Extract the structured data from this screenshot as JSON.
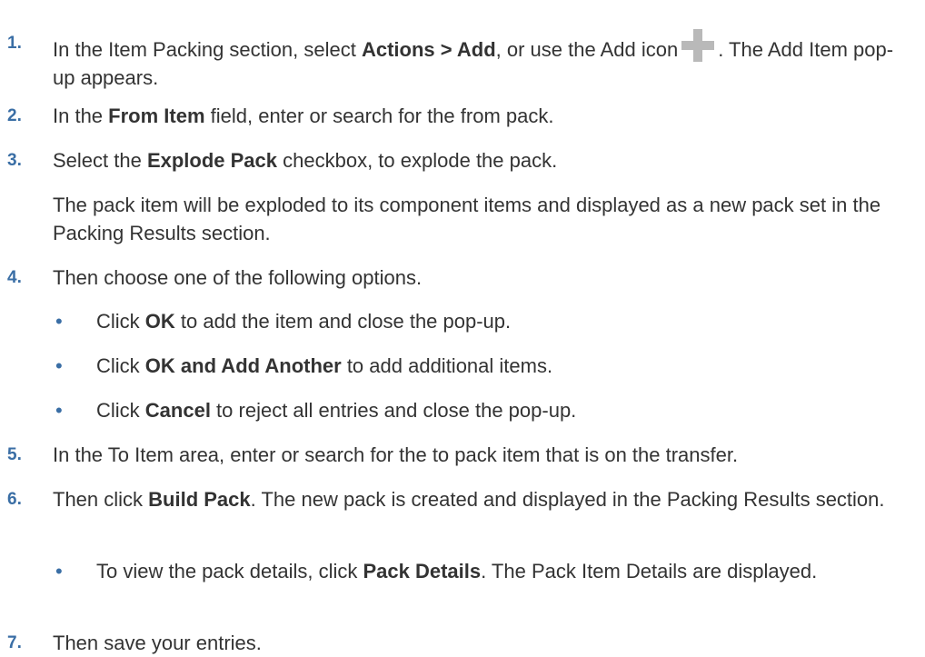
{
  "steps": [
    {
      "num": "1.",
      "a": "In the Item Packing section, select ",
      "b1": "Actions > Add",
      "c": ", or use the Add icon",
      "d": ". The Add Item pop-up appears.",
      "icon": "add-icon"
    },
    {
      "num": "2.",
      "a": "In the ",
      "b1": "From Item",
      "c": " field, enter or search for the from pack."
    },
    {
      "num": "3.",
      "a": "Select the ",
      "b1": "Explode Pack",
      "c": " checkbox, to explode the pack.",
      "para": "The pack item will be exploded to its component items and displayed as a new pack set in the Packing Results section."
    },
    {
      "num": "4.",
      "text": "Then choose one of the following options.",
      "bullets": [
        {
          "a": "Click ",
          "b1": "OK",
          "c": " to add the item and close the pop-up."
        },
        {
          "a": "Click ",
          "b1": "OK and Add Another",
          "c": " to add additional items."
        },
        {
          "a": "Click ",
          "b1": "Cancel",
          "c": " to reject all entries and close the pop-up."
        }
      ]
    },
    {
      "num": "5.",
      "text": "In the To Item area, enter or search for the to pack item that is on the transfer."
    },
    {
      "num": "6.",
      "a": "Then click ",
      "b1": "Build Pack",
      "c": ". The new pack is created and displayed in the Packing Results section.",
      "bullet": {
        "a": "To view the pack details, click ",
        "b1": "Pack Details",
        "c": ". The Pack Item Details are displayed."
      }
    },
    {
      "num": "7.",
      "text": "Then save your entries."
    }
  ],
  "colors": {
    "number": "#3a6ea5",
    "text": "#333333",
    "icon": "#b9b9b9"
  }
}
